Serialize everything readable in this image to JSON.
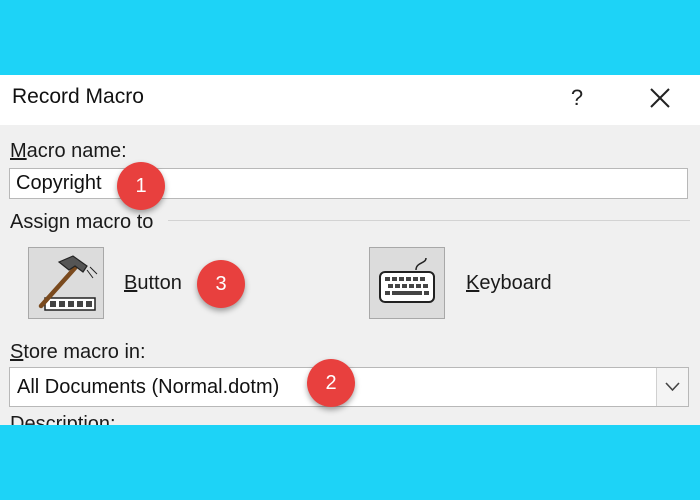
{
  "dialog": {
    "title": "Record Macro",
    "help_label": "?",
    "macro_name_label": {
      "accel": "M",
      "rest": "acro name:"
    },
    "macro_name_value": "Copyright",
    "assign_label": "Assign macro to",
    "button_label": {
      "accel": "B",
      "rest": "utton"
    },
    "keyboard_label": {
      "accel": "K",
      "rest": "eyboard"
    },
    "store_label": {
      "accel": "S",
      "rest": "tore macro in:"
    },
    "store_value": "All Documents (Normal.dotm)",
    "description_label": "Description:"
  },
  "badges": [
    "1",
    "2",
    "3"
  ],
  "colors": {
    "page_bg": "#1dd3f7",
    "badge": "#e8403e",
    "dialog_bg": "#f0f0f0"
  }
}
